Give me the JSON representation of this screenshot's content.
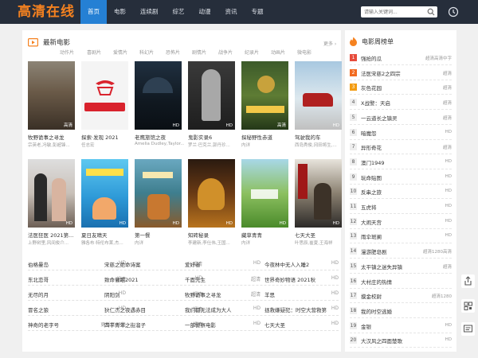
{
  "header": {
    "logo": "高清在线",
    "nav": [
      "首页",
      "电影",
      "连续剧",
      "综艺",
      "动漫",
      "资讯",
      "专题"
    ],
    "search_placeholder": "请输入关键词..."
  },
  "main": {
    "title": "最新电影",
    "more": "更多 ›",
    "categories": [
      "动作片",
      "喜剧片",
      "爱情片",
      "科幻片",
      "恐怖片",
      "剧情片",
      "战争片",
      "纪录片",
      "动画片",
      "微电影"
    ],
    "cards": [
      {
        "title": "牧野诡事之寻龙",
        "desc": "宗英老,冯敏,彭超锋...",
        "badge": "高清"
      },
      {
        "title": "探索·发现 2021",
        "desc": "任志宏",
        "badge": ""
      },
      {
        "title": "老鹰旅馆之夜",
        "desc": "Amelia Dudley,Taylor...",
        "badge": "HD"
      },
      {
        "title": "鬼影实录6",
        "desc": "罗兰·巴克兰,郭丹珍...",
        "badge": "HD"
      },
      {
        "title": "探秘野性赤道",
        "desc": "内详",
        "badge": "高清"
      },
      {
        "title": "驾驶我的车",
        "desc": "西岛秀俊,冈田将生,...",
        "badge": "HD"
      },
      {
        "title": "法医狂医 2021第...",
        "desc": "上野树里,风间俊介...",
        "badge": "HD"
      },
      {
        "title": "夏日友晴天",
        "desc": "雅各布·特伦布莱,杰...",
        "badge": "HD"
      },
      {
        "title": "第一餐",
        "desc": "内详",
        "badge": "HD"
      },
      {
        "title": "知砖秘录",
        "desc": "李建新,李仕伟,王国...",
        "badge": "HD"
      },
      {
        "title": "藏草青青",
        "desc": "内详",
        "badge": "HD"
      },
      {
        "title": "七天大圣",
        "desc": "叶思辰,崔夏,王海祥",
        "badge": "HD"
      }
    ],
    "list_rows": [
      [
        {
          "name": "伯格曼岛",
          "badge": "HD"
        },
        {
          "name": "宋慈之绝命诗案",
          "badge": "超清"
        },
        {
          "name": "爱好者",
          "badge": "HD"
        }
      ],
      [
        {
          "name": "东北恋哥",
          "badge": "超清"
        },
        {
          "name": "致命催眠2021",
          "badge": "HD"
        },
        {
          "name": "千面先生",
          "badge": "超清"
        }
      ],
      [
        {
          "name": "无尽的月",
          "badge": "HD"
        },
        {
          "name": "阴阳剑",
          "badge": "超清"
        },
        {
          "name": "牧野诡事之寻龙",
          "badge": "超清"
        }
      ],
      [
        {
          "name": "冒名之狼",
          "badge": "HD"
        },
        {
          "name": "狄仁杰之夜遇赤目",
          "badge": "超清"
        },
        {
          "name": "我们都无法成为大人",
          "badge": "HD"
        }
      ],
      [
        {
          "name": "神奇的老字号",
          "badge": "更新至07集"
        },
        {
          "name": "四平青年之街溜子",
          "badge": "超清"
        },
        {
          "name": "一部警察电影",
          "badge": "HD"
        }
      ]
    ],
    "list_extra": [
      {
        "name": "今夜林中无人入睡2",
        "badge": "HD"
      },
      {
        "name": "世界奇妙物语 2021秋",
        "badge": "HD"
      },
      {
        "name": "羊思",
        "badge": "HD"
      },
      {
        "name": "拯救嫌疑犯：时空大营救第",
        "badge": "HD"
      },
      {
        "name": "七天大圣",
        "badge": "HD"
      }
    ]
  },
  "ranking": {
    "title": "电影周榜单",
    "items": [
      {
        "name": "强抢的瓜",
        "badge": "超清高清中字"
      },
      {
        "name": "法医宋慈2之四宗",
        "badge": "超清"
      },
      {
        "name": "灰色花园",
        "badge": "超清"
      },
      {
        "name": "X战警：天启",
        "badge": "超清"
      },
      {
        "name": "一云道长之镇灵",
        "badge": "超清"
      },
      {
        "name": "暗魔怨",
        "badge": "HD"
      },
      {
        "name": "异形奇花",
        "badge": "超清"
      },
      {
        "name": "澳门1949",
        "badge": "HD"
      },
      {
        "name": "玩命贴图",
        "badge": "HD"
      },
      {
        "name": "反串之旅",
        "badge": "HD"
      },
      {
        "name": "五虎将",
        "badge": "HD"
      },
      {
        "name": "大闹天宫",
        "badge": "HD"
      },
      {
        "name": "雨伞斑阑",
        "badge": "HD"
      },
      {
        "name": "漫游肥皂剧",
        "badge": "超清1280高清"
      },
      {
        "name": "太平镇之迷失异镇",
        "badge": "超清"
      },
      {
        "name": "大村庄的热情",
        "badge": ""
      },
      {
        "name": "摸金校尉",
        "badge": "超清1280"
      },
      {
        "name": "我的时空逃婚",
        "badge": ""
      },
      {
        "name": "金银",
        "badge": "HD"
      },
      {
        "name": "大汉风之四面楚歌",
        "badge": "HD"
      }
    ]
  },
  "colors": {
    "header_bg": "#262e3b",
    "logo": "#f58220",
    "nav_active": "#2580d4",
    "rank1": "#e74c3c",
    "rank2": "#f26b21",
    "rank3": "#f39c12"
  }
}
